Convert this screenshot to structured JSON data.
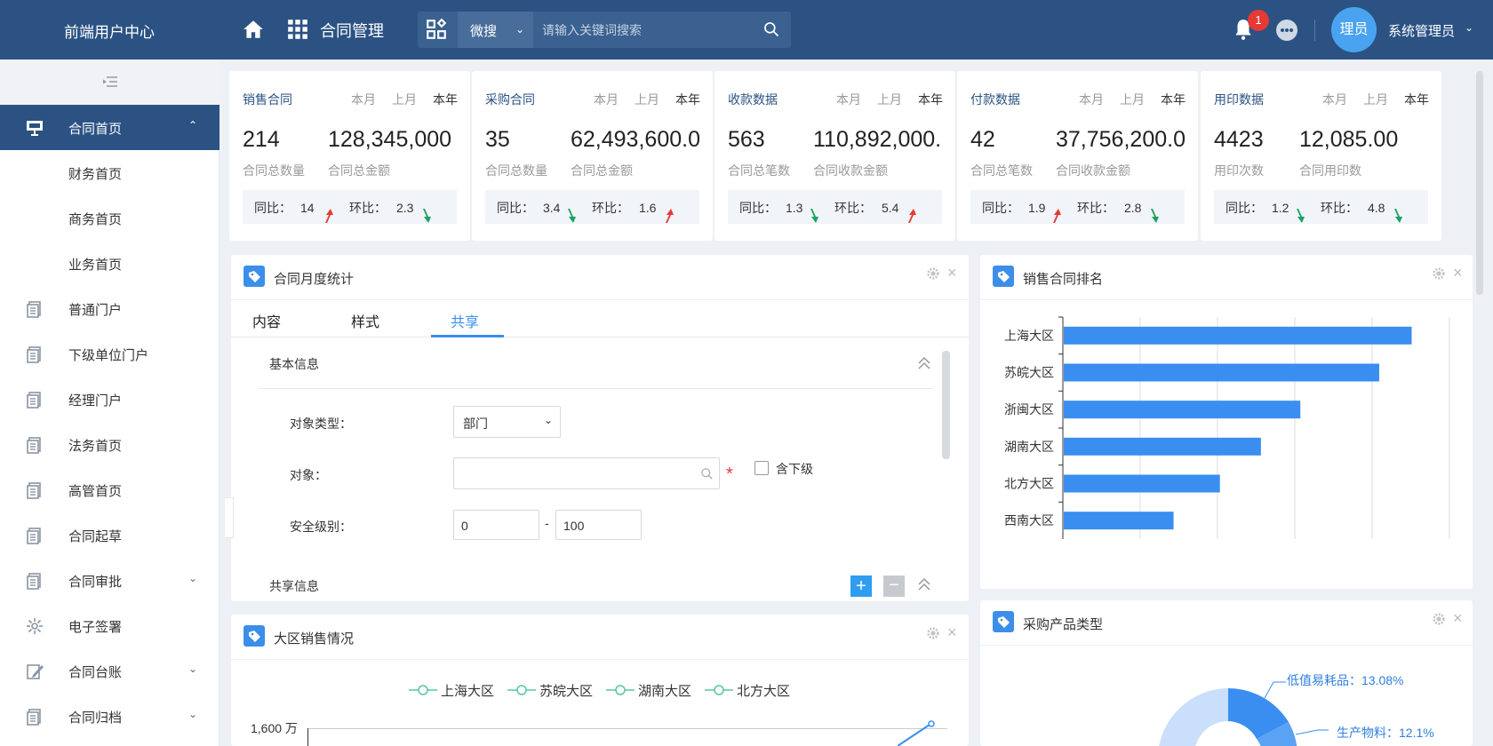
{
  "header": {
    "brand": "前端用户中心",
    "module": "合同管理",
    "search_type": "微搜",
    "search_placeholder": "请输入关键词搜索",
    "notifications": "1",
    "avatar": "理员",
    "username": "系统管理员"
  },
  "sidebar": {
    "items": [
      {
        "label": "合同首页",
        "icon": "presentation-icon",
        "active": true,
        "chevron": "up"
      },
      {
        "label": "财务首页"
      },
      {
        "label": "商务首页"
      },
      {
        "label": "业务首页"
      },
      {
        "label": "普通门户",
        "icon": "document-icon"
      },
      {
        "label": "下级单位门户",
        "icon": "document-icon"
      },
      {
        "label": "经理门户",
        "icon": "document-icon"
      },
      {
        "label": "法务首页",
        "icon": "document-icon"
      },
      {
        "label": "高管首页",
        "icon": "document-icon"
      },
      {
        "label": "合同起草",
        "icon": "document-icon"
      },
      {
        "label": "合同审批",
        "icon": "document-icon",
        "chevron": "down"
      },
      {
        "label": "电子签署",
        "icon": "signature-icon"
      },
      {
        "label": "合同台账",
        "icon": "ledger-icon",
        "chevron": "down"
      },
      {
        "label": "合同归档",
        "icon": "archive-icon",
        "chevron": "down"
      }
    ]
  },
  "period_tabs": [
    "本月",
    "上月",
    "本年"
  ],
  "stats": [
    {
      "title": "销售合同",
      "n1": "214",
      "n2": "128,345,000",
      "l1": "合同总数量",
      "l2": "合同总金额",
      "yoy_label": "同比：",
      "yoy": "14",
      "yoy_dir": "up",
      "mom_label": "环比：",
      "mom": "2.3",
      "mom_dir": "down"
    },
    {
      "title": "采购合同",
      "n1": "35",
      "n2": "62,493,600.0",
      "l1": "合同总数量",
      "l2": "合同总金额",
      "yoy_label": "同比：",
      "yoy": "3.4",
      "yoy_dir": "down",
      "mom_label": "环比：",
      "mom": "1.6",
      "mom_dir": "up"
    },
    {
      "title": "收款数据",
      "n1": "563",
      "n2": "110,892,000.",
      "l1": "合同总笔数",
      "l2": "合同收款金额",
      "yoy_label": "同比：",
      "yoy": "1.3",
      "yoy_dir": "down",
      "mom_label": "环比：",
      "mom": "5.4",
      "mom_dir": "up"
    },
    {
      "title": "付款数据",
      "n1": "42",
      "n2": "37,756,200.0",
      "l1": "合同总笔数",
      "l2": "合同收款金额",
      "yoy_label": "同比：",
      "yoy": "1.9",
      "yoy_dir": "up",
      "mom_label": "环比：",
      "mom": "2.8",
      "mom_dir": "down"
    },
    {
      "title": "用印数据",
      "n1": "4423",
      "n2": "12,085.00",
      "l1": "用印次数",
      "l2": "合同用印数",
      "yoy_label": "同比：",
      "yoy": "1.2",
      "yoy_dir": "down",
      "mom_label": "环比：",
      "mom": "4.8",
      "mom_dir": "down"
    }
  ],
  "monthly_panel": {
    "title": "合同月度统计",
    "tabs": [
      "内容",
      "样式",
      "共享"
    ],
    "active_tab": "共享",
    "section1": "基本信息",
    "object_type_label": "对象类型：",
    "object_type_value": "部门",
    "object_label": "对象：",
    "include_sub_label": "含下级",
    "security_label": "安全级别：",
    "security_min": "0",
    "security_sep": "-",
    "security_max": "100",
    "section2": "共享信息"
  },
  "region_panel": {
    "title": "大区销售情况",
    "legend": [
      "上海大区",
      "苏皖大区",
      "湖南大区",
      "北方大区"
    ],
    "y_top_label": "1,600 万"
  },
  "ranking_panel": {
    "title": "销售合同排名"
  },
  "purchase_panel": {
    "title": "采购产品类型",
    "labels": [
      "低值易耗品：13.08%",
      "生产物料：12.1%"
    ]
  },
  "colors": {
    "header": "#2b5283",
    "accent": "#3a8ef0",
    "bar": "#3a8ef0",
    "up": "#e53935",
    "down": "#1aa260"
  },
  "chart_data": [
    {
      "type": "bar",
      "orientation": "horizontal",
      "categories": [
        "上海大区",
        "苏皖大区",
        "浙闽大区",
        "湖南大区",
        "北方大区",
        "西南大区"
      ],
      "values": [
        450,
        408,
        306,
        255,
        202,
        142
      ],
      "xlim": [
        0,
        500
      ],
      "grid": true
    },
    {
      "type": "pie",
      "labels": [
        "低值易耗品",
        "生产物料"
      ],
      "values": [
        13.08,
        12.1
      ]
    }
  ]
}
